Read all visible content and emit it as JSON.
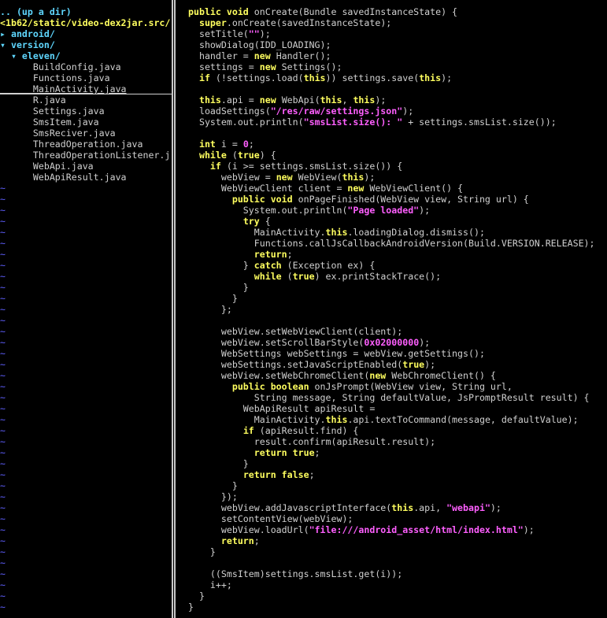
{
  "tree": {
    "lines": [
      {
        "text": ".. (up a dir)",
        "kind": "dir-up"
      },
      {
        "text": "<1b62/static/video-dex2jar.src/",
        "kind": "root"
      },
      {
        "text": "▸ android/",
        "kind": "folder"
      },
      {
        "text": "▾ version/",
        "kind": "folder"
      },
      {
        "text": "  ▾ eleven/",
        "kind": "folder"
      },
      {
        "text": "      BuildConfig.java",
        "kind": "file"
      },
      {
        "text": "      Functions.java",
        "kind": "file"
      },
      {
        "text": "      MainActivity.java",
        "kind": "file",
        "cursor": true
      },
      {
        "text": "      R.java",
        "kind": "file"
      },
      {
        "text": "      Settings.java",
        "kind": "file"
      },
      {
        "text": "      SmsItem.java",
        "kind": "file"
      },
      {
        "text": "      SmsReciver.java",
        "kind": "file"
      },
      {
        "text": "      ThreadOperation.java",
        "kind": "file"
      },
      {
        "text": "      ThreadOperationListener.j",
        "kind": "file"
      },
      {
        "text": "      WebApi.java",
        "kind": "file"
      },
      {
        "text": "      WebApiResult.java",
        "kind": "file"
      }
    ],
    "tilde_char": "~"
  },
  "code": {
    "lines": [
      [
        [
          "kw",
          "public void"
        ],
        [
          "p",
          " onCreate(Bundle savedInstanceState) {"
        ]
      ],
      [
        [
          "p",
          "  "
        ],
        [
          "kw",
          "super"
        ],
        [
          "p",
          ".onCreate(savedInstanceState);"
        ]
      ],
      [
        [
          "p",
          "  setTitle("
        ],
        [
          "str",
          "\"\""
        ],
        [
          "p",
          ");"
        ]
      ],
      [
        [
          "p",
          "  showDialog(IDD_LOADING);"
        ]
      ],
      [
        [
          "p",
          "  handler = "
        ],
        [
          "kw",
          "new"
        ],
        [
          "p",
          " Handler();"
        ]
      ],
      [
        [
          "p",
          "  settings = "
        ],
        [
          "kw",
          "new"
        ],
        [
          "p",
          " Settings();"
        ]
      ],
      [
        [
          "p",
          "  "
        ],
        [
          "kw",
          "if"
        ],
        [
          "p",
          " (!settings.load("
        ],
        [
          "kw",
          "this"
        ],
        [
          "p",
          ")) settings.save("
        ],
        [
          "kw",
          "this"
        ],
        [
          "p",
          ");"
        ]
      ],
      [
        [
          "p",
          ""
        ]
      ],
      [
        [
          "p",
          "  "
        ],
        [
          "kw",
          "this"
        ],
        [
          "p",
          ".api = "
        ],
        [
          "kw",
          "new"
        ],
        [
          "p",
          " WebApi("
        ],
        [
          "kw",
          "this"
        ],
        [
          "p",
          ", "
        ],
        [
          "kw",
          "this"
        ],
        [
          "p",
          ");"
        ]
      ],
      [
        [
          "p",
          "  loadSettings("
        ],
        [
          "str",
          "\"/res/raw/settings.json\""
        ],
        [
          "p",
          ");"
        ]
      ],
      [
        [
          "p",
          "  System.out.println("
        ],
        [
          "str",
          "\"smsList.size(): \""
        ],
        [
          "p",
          " + settings.smsList.size());"
        ]
      ],
      [
        [
          "p",
          ""
        ]
      ],
      [
        [
          "p",
          "  "
        ],
        [
          "kw",
          "int"
        ],
        [
          "p",
          " i = "
        ],
        [
          "num",
          "0"
        ],
        [
          "p",
          ";"
        ]
      ],
      [
        [
          "p",
          "  "
        ],
        [
          "kw",
          "while"
        ],
        [
          "p",
          " ("
        ],
        [
          "kw",
          "true"
        ],
        [
          "p",
          ") {"
        ]
      ],
      [
        [
          "p",
          "    "
        ],
        [
          "kw",
          "if"
        ],
        [
          "p",
          " (i >= settings.smsList.size()) {"
        ]
      ],
      [
        [
          "p",
          "      webView = "
        ],
        [
          "kw",
          "new"
        ],
        [
          "p",
          " WebView("
        ],
        [
          "kw",
          "this"
        ],
        [
          "p",
          ");"
        ]
      ],
      [
        [
          "p",
          "      WebViewClient client = "
        ],
        [
          "kw",
          "new"
        ],
        [
          "p",
          " WebViewClient() {"
        ]
      ],
      [
        [
          "p",
          "        "
        ],
        [
          "kw",
          "public void"
        ],
        [
          "p",
          " onPageFinished(WebView view, String url) {"
        ]
      ],
      [
        [
          "p",
          "          System.out.println("
        ],
        [
          "str",
          "\"Page loaded\""
        ],
        [
          "p",
          ");"
        ]
      ],
      [
        [
          "p",
          "          "
        ],
        [
          "kw",
          "try"
        ],
        [
          "p",
          " {"
        ]
      ],
      [
        [
          "p",
          "            MainActivity."
        ],
        [
          "kw",
          "this"
        ],
        [
          "p",
          ".loadingDialog.dismiss();"
        ]
      ],
      [
        [
          "p",
          "            Functions.callJsCallbackAndroidVersion(Build.VERSION.RELEASE);"
        ]
      ],
      [
        [
          "p",
          "            "
        ],
        [
          "kw",
          "return"
        ],
        [
          "p",
          ";"
        ]
      ],
      [
        [
          "p",
          "          } "
        ],
        [
          "kw",
          "catch"
        ],
        [
          "p",
          " (Exception ex) {"
        ]
      ],
      [
        [
          "p",
          "            "
        ],
        [
          "kw",
          "while"
        ],
        [
          "p",
          " ("
        ],
        [
          "kw",
          "true"
        ],
        [
          "p",
          ") ex.printStackTrace();"
        ]
      ],
      [
        [
          "p",
          "          }"
        ]
      ],
      [
        [
          "p",
          "        }"
        ]
      ],
      [
        [
          "p",
          "      };"
        ]
      ],
      [
        [
          "p",
          ""
        ]
      ],
      [
        [
          "p",
          "      webView.setWebViewClient(client);"
        ]
      ],
      [
        [
          "p",
          "      webView.setScrollBarStyle("
        ],
        [
          "num",
          "0x02000000"
        ],
        [
          "p",
          ");"
        ]
      ],
      [
        [
          "p",
          "      WebSettings webSettings = webView.getSettings();"
        ]
      ],
      [
        [
          "p",
          "      webSettings.setJavaScriptEnabled("
        ],
        [
          "kw",
          "true"
        ],
        [
          "p",
          ");"
        ]
      ],
      [
        [
          "p",
          "      webView.setWebChromeClient("
        ],
        [
          "kw",
          "new"
        ],
        [
          "p",
          " WebChromeClient() {"
        ]
      ],
      [
        [
          "p",
          "        "
        ],
        [
          "kw",
          "public boolean"
        ],
        [
          "p",
          " onJsPrompt(WebView view, String url,"
        ]
      ],
      [
        [
          "p",
          "            String message, String defaultValue, JsPromptResult result) {"
        ]
      ],
      [
        [
          "p",
          "          WebApiResult apiResult ="
        ]
      ],
      [
        [
          "p",
          "            MainActivity."
        ],
        [
          "kw",
          "this"
        ],
        [
          "p",
          ".api.textToCommand(message, defaultValue);"
        ]
      ],
      [
        [
          "p",
          "          "
        ],
        [
          "kw",
          "if"
        ],
        [
          "p",
          " (apiResult.find) {"
        ]
      ],
      [
        [
          "p",
          "            result.confirm(apiResult.result);"
        ]
      ],
      [
        [
          "p",
          "            "
        ],
        [
          "kw",
          "return true"
        ],
        [
          "p",
          ";"
        ]
      ],
      [
        [
          "p",
          "          }"
        ]
      ],
      [
        [
          "p",
          "          "
        ],
        [
          "kw",
          "return false"
        ],
        [
          "p",
          ";"
        ]
      ],
      [
        [
          "p",
          "        }"
        ]
      ],
      [
        [
          "p",
          "      });"
        ]
      ],
      [
        [
          "p",
          "      webView.addJavascriptInterface("
        ],
        [
          "kw",
          "this"
        ],
        [
          "p",
          ".api, "
        ],
        [
          "str",
          "\"webapi\""
        ],
        [
          "p",
          ");"
        ]
      ],
      [
        [
          "p",
          "      setContentView(webView);"
        ]
      ],
      [
        [
          "p",
          "      webView.loadUrl("
        ],
        [
          "str",
          "\"file:///android_asset/html/index.html\""
        ],
        [
          "p",
          ");"
        ]
      ],
      [
        [
          "p",
          "      "
        ],
        [
          "kw",
          "return"
        ],
        [
          "p",
          ";"
        ]
      ],
      [
        [
          "p",
          "    }"
        ]
      ],
      [
        [
          "p",
          ""
        ]
      ],
      [
        [
          "p",
          "    ((SmsItem)settings.smsList.get(i));"
        ]
      ],
      [
        [
          "p",
          "    i++;"
        ]
      ],
      [
        [
          "p",
          "  }"
        ]
      ],
      [
        [
          "p",
          "}"
        ]
      ]
    ]
  },
  "colors": {
    "keyword": "#ffff5f",
    "string": "#ff5fff",
    "folder": "#5fd7ff",
    "tilde": "#5f5fff",
    "text": "#d0d0d0",
    "background": "#000000"
  }
}
